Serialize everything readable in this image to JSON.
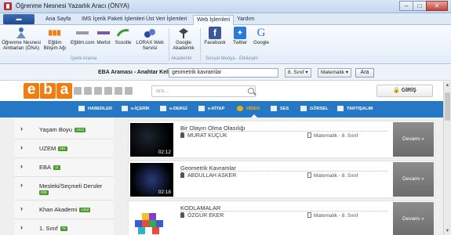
{
  "window": {
    "title": "Öğrenme Nesnesi Yazarlık Aracı (ÖNYA)",
    "controls": [
      "–",
      "□",
      "✕"
    ]
  },
  "ribbon": {
    "app_menu_label": "",
    "tabs": [
      "Ana Sayfa",
      "IMS İçerik Paketi İşlemleri",
      "Üst Veri İşlemleri",
      "Web İşlemleri",
      "Yardım"
    ],
    "active_tab": "Web İşlemleri",
    "buttons": [
      {
        "label1": "Öğrenme Nesnesi",
        "label2": "Ambarları (ÖNA)",
        "icon": "repository-icon"
      },
      {
        "label1": "Eğitim",
        "label2": "Bilişim Ağı",
        "icon": "eba-icon"
      },
      {
        "label1": "Eğitim.com",
        "label2": "",
        "icon": "egitim-com-icon"
      },
      {
        "label1": "Merlot",
        "label2": "",
        "icon": "merlot-icon"
      },
      {
        "label1": "Scootle",
        "label2": "",
        "icon": "scootle-icon"
      },
      {
        "label1": "LORAX Web",
        "label2": "Servisi",
        "icon": "lorax-icon"
      },
      {
        "label1": "Google",
        "label2": "Akademik",
        "icon": "google-scholar-icon"
      },
      {
        "label1": "Facebook",
        "label2": "",
        "icon": "facebook-icon"
      },
      {
        "label1": "Twitter",
        "label2": "",
        "icon": "twitter-icon"
      },
      {
        "label1": "Google",
        "label2": "",
        "icon": "google-icon"
      }
    ],
    "groups": [
      "İçerik Arama",
      "Akademik",
      "Sosyal Medya - Etkileşim"
    ]
  },
  "search_strip": {
    "label": "EBA Araması - Anahtar Kelime:",
    "query": "geometrik kavramlar",
    "grade": "8. Sınıf",
    "subject": "Matematik",
    "button": "Ara"
  },
  "eba": {
    "logo": [
      "e",
      "b",
      "a"
    ],
    "search_placeholder": "ara...",
    "login": "🔒 GİRİŞ",
    "nav": [
      "HABERLER",
      "e-İÇERİK",
      "e-DERGİ",
      "e-KİTAP",
      "VİDEO",
      "SES",
      "GÖRSEL",
      "TARTIŞALIM"
    ],
    "active_nav": "VİDEO",
    "sidebar": [
      {
        "label": "Yaşam Boyu",
        "count": "1313"
      },
      {
        "label": "UZEM",
        "count": "581"
      },
      {
        "label": "EBA",
        "count": "11"
      },
      {
        "label": "Mesleki/Seçmeli Dersler",
        "count": "839"
      },
      {
        "label": "Khan Akademi",
        "count": "1462"
      },
      {
        "label": "1. Sınıf",
        "count": "75"
      }
    ],
    "results": [
      {
        "title": "Bir Olayın Olma Olasılığı",
        "author": "MURAT KÜÇÜK",
        "meta": "Matematik - 8. Sınıf",
        "duration": "02:12",
        "more": "Devamı »"
      },
      {
        "title": "Geometrik Kavramlar",
        "author": "ABDULLAH ASKER",
        "meta": "Matematik - 8. Sınıf",
        "duration": "02:18",
        "more": "Devamı »"
      },
      {
        "title": "KODLAMALAR",
        "author": "ÖZGÜR EKER",
        "meta": "Matematik - 8. Sınıf",
        "duration": "",
        "more": "Devamı »"
      }
    ]
  },
  "colors": {
    "eba_orange": "#ef7d10",
    "nav_blue": "#2677c4",
    "accent": "#ffb300"
  }
}
